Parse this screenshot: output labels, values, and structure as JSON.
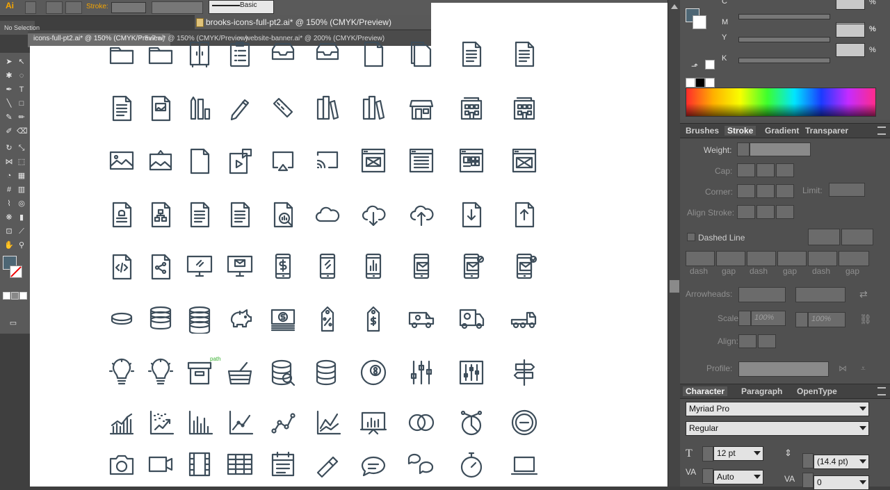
{
  "app": {
    "logo": "Ai"
  },
  "control_bar": {
    "stroke_label": "Stroke:",
    "brush_label": "Basic",
    "selection_label": "No Selection"
  },
  "document": {
    "title": "brooks-icons-full-pt2.ai* @ 150% (CMYK/Preview)",
    "tabs": [
      {
        "label": "icons-full-pt2.ai* @ 150% (CMYK/Preview)",
        "active": true
      },
      {
        "label": "5x7.ai* @ 150% (CMYK/Preview)",
        "active": false
      },
      {
        "label": "website-banner.ai* @ 200% (CMYK/Preview)",
        "active": false
      }
    ],
    "snap_label": "path"
  },
  "icon_grid": {
    "stroke_color": "#3d4d5a",
    "rows": [
      [
        "folder-icon",
        "folder-open-icon",
        "wardrobe-icon",
        "clipboard-list-icon",
        "inbox-tray-icon",
        "inbox-archive-icon",
        "document-blank-icon",
        "documents-stack-icon",
        "document-text-icon",
        "document-list-icon"
      ],
      [
        "document-lines-icon",
        "document-image-icon",
        "pencils-ruler-icon",
        "pencil-icon",
        "ruler-icon",
        "books-icon",
        "books-stack-icon",
        "storefront-icon",
        "city-building-icon",
        "office-building-icon"
      ],
      [
        "image-icon",
        "framed-picture-icon",
        "video-file-icon",
        "video-message-icon",
        "airplay-icon",
        "cast-icon",
        "web-layout-icon",
        "web-list-icon",
        "web-dashboard-icon",
        "web-article-icon"
      ],
      [
        "document-bell-icon",
        "sitemap-document-icon",
        "newspaper-icon",
        "newspaper-stack-icon",
        "document-chart-search-icon",
        "cloud-icon",
        "cloud-download-icon",
        "cloud-upload-icon",
        "file-download-icon",
        "file-upload-icon"
      ],
      [
        "code-file-icon",
        "share-file-icon",
        "monitor-icon",
        "monitor-mail-icon",
        "mobile-dollar-icon",
        "mobile-icon",
        "mobile-chart-icon",
        "mobile-mail-icon",
        "mobile-mail-send-icon",
        "mobile-mail-check-icon"
      ],
      [
        "coin-icon",
        "coins-stack-icon",
        "coins-tall-icon",
        "piggy-bank-icon",
        "cash-stack-icon",
        "price-tag-percent-icon",
        "price-tag-dollar-icon",
        "delivery-van-icon",
        "delivery-truck-icon",
        "semi-truck-icon"
      ],
      [
        "lightbulb-off-icon",
        "lightbulb-on-icon",
        "archive-box-icon",
        "shopping-basket-icon",
        "database-search-icon",
        "database-icon",
        "eight-ball-icon",
        "mixer-sliders-icon",
        "equalizer-box-icon",
        "signpost-icon"
      ],
      [
        "bar-line-chart-icon",
        "scatter-trend-icon",
        "bar-chart-icon",
        "line-graph-icon",
        "trend-points-icon",
        "dual-line-chart-icon",
        "presentation-board-icon",
        "overlapping-circles-icon",
        "pie-gauge-icon",
        "circle-minus-icon"
      ],
      [
        "camera-icon",
        "video-camera-icon",
        "film-strip-icon",
        "table-grid-icon",
        "calendar-icon",
        "usb-drive-icon",
        "chat-bubble-icon",
        "chat-bubbles-icon",
        "stopwatch-icon",
        "laptop-icon"
      ]
    ]
  },
  "color_panel": {
    "channels": [
      {
        "label": "C",
        "value": "",
        "unit": "%"
      },
      {
        "label": "M",
        "value": "",
        "unit": "%"
      },
      {
        "label": "Y",
        "value": "",
        "unit": "%"
      },
      {
        "label": "K",
        "value": "",
        "unit": "%"
      }
    ]
  },
  "stroke_panel": {
    "tabs": [
      "Brushes",
      "Stroke",
      "Gradient",
      "Transparer"
    ],
    "weight_label": "Weight:",
    "cap_label": "Cap:",
    "corner_label": "Corner:",
    "limit_label": "Limit:",
    "align_label": "Align Stroke:",
    "dashed_label": "Dashed Line",
    "dash_labels": [
      "dash",
      "gap",
      "dash",
      "gap",
      "dash",
      "gap"
    ],
    "arrowheads_label": "Arrowheads:",
    "scale_label": "Scale:",
    "scale_values": [
      "100%",
      "100%"
    ],
    "align_arrow_label": "Align:",
    "profile_label": "Profile:"
  },
  "character_panel": {
    "tabs": [
      "Character",
      "Paragraph",
      "OpenType"
    ],
    "font_family": "Myriad Pro",
    "font_style": "Regular",
    "font_size": "12 pt",
    "leading": "(14.4 pt)",
    "kerning": "Auto",
    "tracking": "0"
  }
}
